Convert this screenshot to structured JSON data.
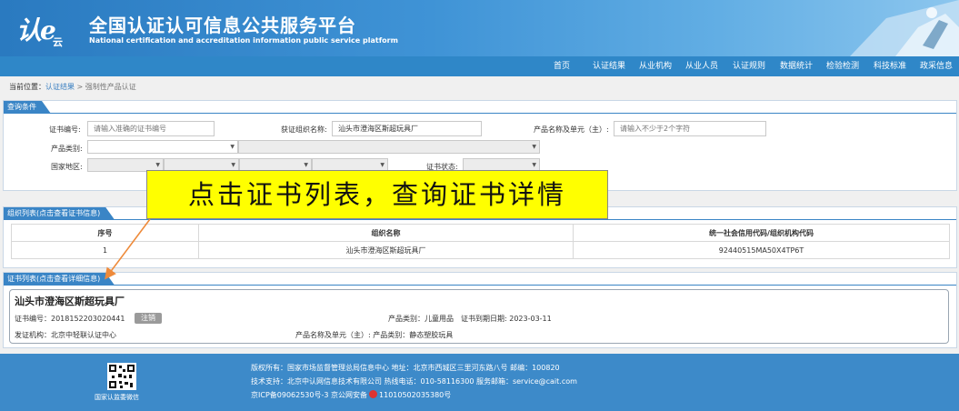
{
  "header": {
    "logo_text": "认e",
    "logo_sub": "云",
    "title": "全国认证认可信息公共服务平台",
    "subtitle": "National certification and accreditation information public service platform"
  },
  "nav": [
    "首页",
    "认证结果",
    "从业机构",
    "从业人员",
    "认证规则",
    "数据统计",
    "检验检测",
    "科技标准",
    "政采信息"
  ],
  "breadcrumb": {
    "prefix": "当前位置：",
    "link": "认证结果",
    "separator": ">",
    "current": "强制性产品认证"
  },
  "query": {
    "tab": "查询条件",
    "cert_no_label": "证书编号:",
    "cert_no_placeholder": "请输入准确的证书编号",
    "org_label": "获证组织名称:",
    "org_value": "汕头市澄海区斯超玩具厂",
    "product_label": "产品名称及单元（主）:",
    "product_placeholder": "请输入不少于2个字符",
    "category_label": "产品类别:",
    "region_label": "国家地区:",
    "status_label": "证书状态:"
  },
  "annotation": "点击证书列表，查询证书详情",
  "org_list": {
    "tab": "组织列表(点击查看证书信息)",
    "columns": [
      "序号",
      "组织名称",
      "统一社会信用代码/组织机构代码"
    ],
    "rows": [
      [
        "1",
        "汕头市澄海区斯超玩具厂",
        "92440515MA50X4TP6T"
      ]
    ]
  },
  "cert_list": {
    "tab": "证书列表(点击查看详细信息)",
    "org_name": "汕头市澄海区斯超玩具厂",
    "cert_no": "证书编号：2018152203020441",
    "status_badge": "注销",
    "category": "产品类别：儿童用品",
    "expiry": "证书到期日期: 2023-03-11",
    "issuer": "发证机构：北京中轻联认证中心",
    "product": "产品名称及单元（主）: 产品类别：静态塑胶玩具"
  },
  "footer": {
    "qr_caption": "国家认监委微信",
    "line1": "版权所有：国家市场监督管理总局信息中心    地址：北京市西城区三里河东路八号    邮编：100820",
    "line2": "技术支持：北京中认网信息技术有限公司    热线电话：010-58116300    服务邮箱：service@cait.com",
    "line3_a": "京ICP备09062530号-3    京公网安备",
    "line3_b": "11010502035380号"
  },
  "colors": {
    "header_blue": "#2a7ac0",
    "nav_blue": "#2f87c8",
    "tab_blue": "#3a85c6",
    "callout_yellow": "#ffff00",
    "arrow_orange": "#ee8a3a"
  }
}
